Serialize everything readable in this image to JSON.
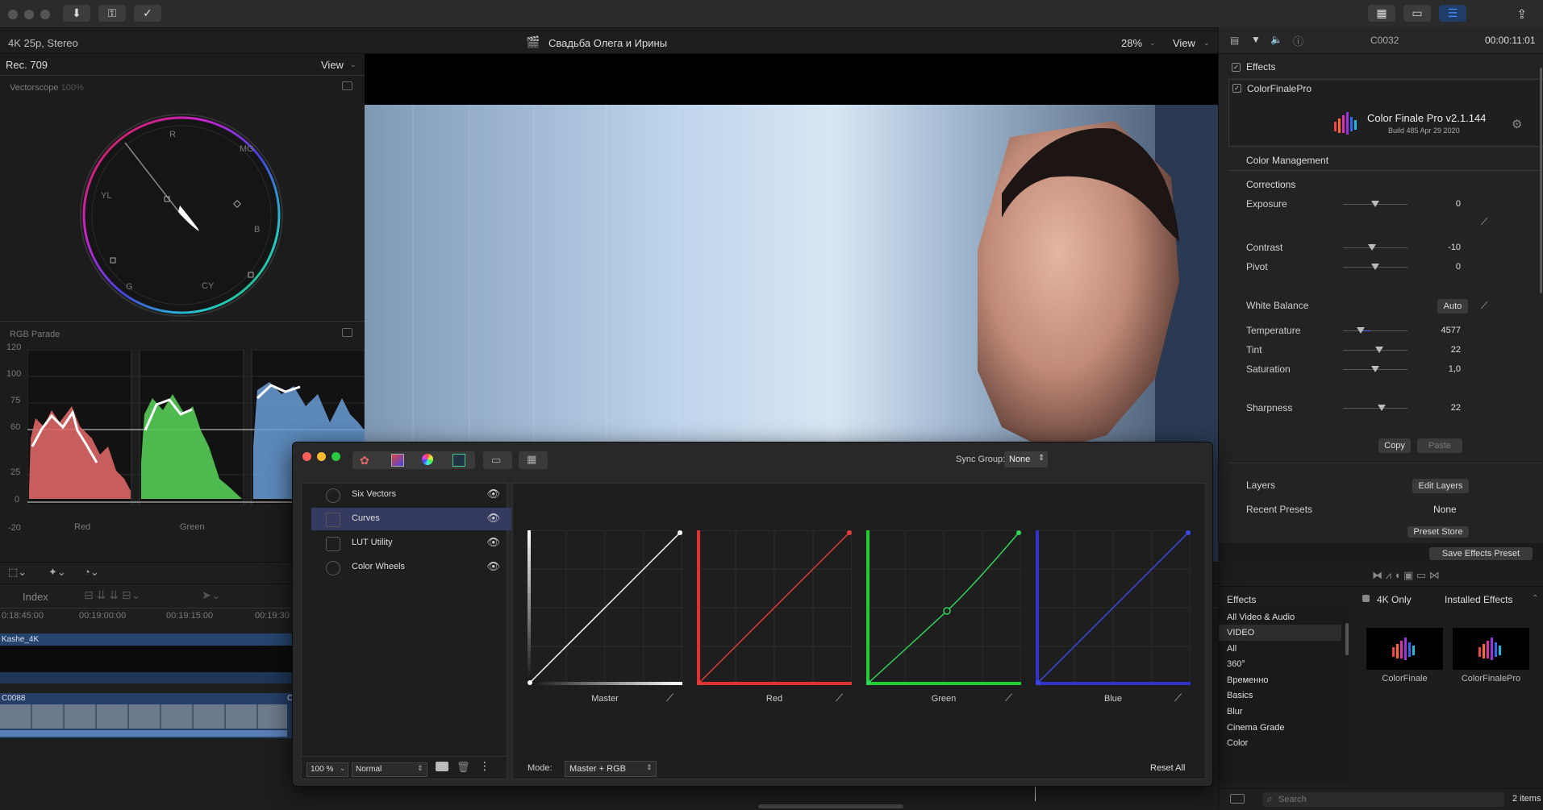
{
  "toolbar": {
    "buttons": [
      "download-icon",
      "key-icon",
      "check-icon"
    ],
    "right_buttons": [
      "grid-icon",
      "filmstrip-icon",
      "sliders-icon"
    ],
    "share": "share-icon"
  },
  "viewer_bar": {
    "format": "4K 25p, Stereo",
    "project_title": "Свадьба Олега и Ирины",
    "zoom": "28%",
    "view": "View"
  },
  "scopes": {
    "color_space": "Rec. 709",
    "view": "View",
    "vectorscope_label": "Vectorscope",
    "vectorscope_pct": "100%",
    "vector_targets": [
      "R",
      "MG",
      "B",
      "CY",
      "G",
      "YL"
    ],
    "parade_label": "RGB Parade",
    "parade_scale": [
      "120",
      "100",
      "75",
      "60",
      "25",
      "0",
      "-20"
    ],
    "parade_channels": [
      "Red",
      "Green"
    ]
  },
  "timeline": {
    "index": "Index",
    "timecodes": [
      "0:18:45:00",
      "00:19:00:00",
      "00:19:15:00",
      "00:19:30"
    ],
    "clip1": "Kashe_4K",
    "clip2": "C0088",
    "clip3": "C"
  },
  "inspector": {
    "clip_name": "C0032",
    "timecode": "00:00:11:01",
    "effects_label": "Effects",
    "plugin_name": "ColorFinalePro",
    "plugin_title": "Color Finale Pro v2.1.144",
    "plugin_build": "Build 485 Apr 29 2020",
    "color_management": "Color Management",
    "corrections": "Corrections",
    "rows": [
      {
        "label": "Exposure",
        "value": "0",
        "pos": 0.5
      },
      {
        "label": "Contrast",
        "value": "-10",
        "pos": 0.45
      },
      {
        "label": "Pivot",
        "value": "0",
        "pos": 0.5
      },
      {
        "label": "Temperature",
        "value": "4577",
        "pos": 0.27
      },
      {
        "label": "Tint",
        "value": "22",
        "pos": 0.56
      },
      {
        "label": "Saturation",
        "value": "1,0",
        "pos": 0.5
      },
      {
        "label": "Sharpness",
        "value": "22",
        "pos": 0.6
      }
    ],
    "white_balance": "White Balance",
    "auto": "Auto",
    "copy": "Copy",
    "paste": "Paste",
    "layers": "Layers",
    "edit_layers": "Edit Layers",
    "recent_presets": "Recent Presets",
    "recent_value": "None",
    "preset_store": "Preset Store",
    "save_preset": "Save Effects Preset"
  },
  "browser": {
    "title": "Effects",
    "filter": "4K Only",
    "installed": "Installed Effects",
    "categories": [
      "All Video & Audio",
      "VIDEO",
      "All",
      "360°",
      "Временно",
      "Basics",
      "Blur",
      "Cinema Grade",
      "Color"
    ],
    "thumbs": [
      "ColorFinale",
      "ColorFinalePro"
    ],
    "search_placeholder": "Search",
    "count": "2 items"
  },
  "cf_window": {
    "sync_label": "Sync Group:",
    "sync_value": "None",
    "layers": [
      {
        "name": "Six Vectors",
        "selected": false
      },
      {
        "name": "Curves",
        "selected": true
      },
      {
        "name": "LUT Utility",
        "selected": false
      },
      {
        "name": "Color Wheels",
        "selected": false
      }
    ],
    "opacity": "100 %",
    "blend": "Normal",
    "mode_label": "Mode:",
    "mode_value": "Master + RGB",
    "reset_all": "Reset All",
    "curves": [
      {
        "name": "Master",
        "color": "#ffffff"
      },
      {
        "name": "Red",
        "color": "#e23a3a"
      },
      {
        "name": "Green",
        "color": "#2fd35a"
      },
      {
        "name": "Blue",
        "color": "#3b47e0"
      }
    ]
  }
}
